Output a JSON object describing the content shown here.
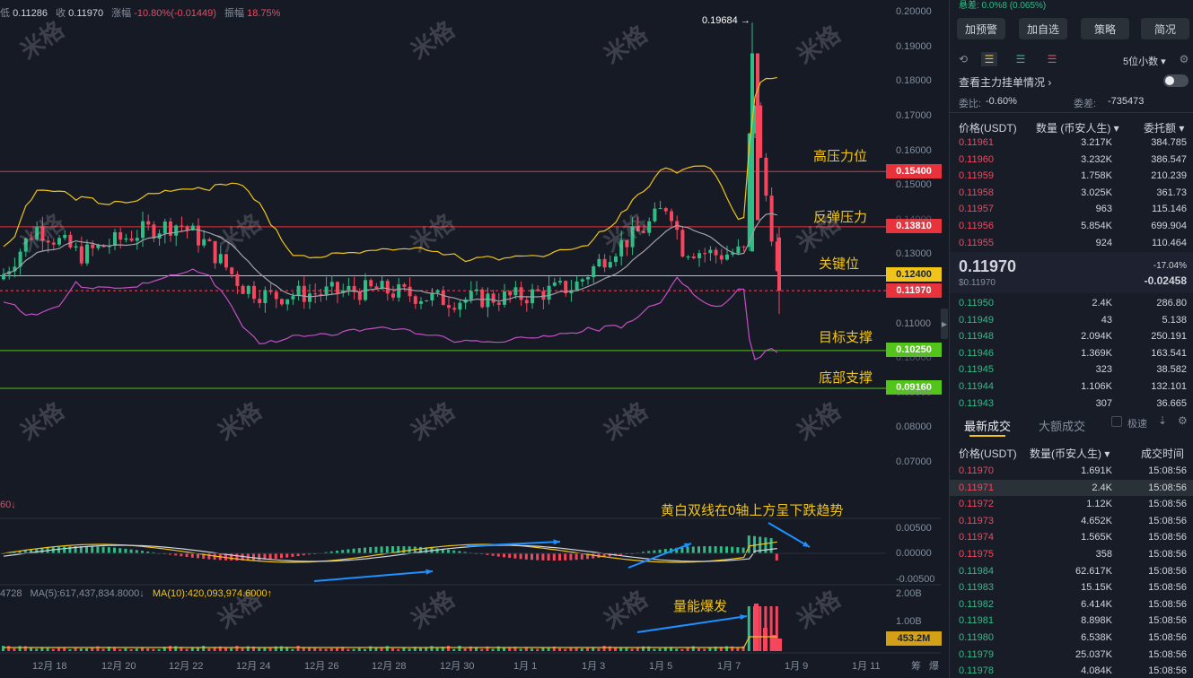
{
  "ohlc": {
    "low_label": "低",
    "low": "0.11286",
    "close_label": "收",
    "close": "0.11970",
    "change_label": "涨幅",
    "change": "-10.80%(-0.01449)",
    "amp_label": "振幅",
    "amp": "18.75%"
  },
  "watermark": "米格",
  "price_axis": [
    "0.20000",
    "0.19000",
    "0.18000",
    "0.17000",
    "0.16000",
    "0.15000",
    "0.14000",
    "0.13000",
    "0.12000",
    "0.11000",
    "0.10000",
    "0.09000",
    "0.08000",
    "0.07000"
  ],
  "macd_axis": [
    "0.00500",
    "0.00000",
    "-0.00500"
  ],
  "vol_axis": [
    "2.00B",
    "1.00B"
  ],
  "date_axis": [
    "12月 18",
    "12月 20",
    "12月 22",
    "12月 24",
    "12月 26",
    "12月 28",
    "12月 30",
    "1月 1",
    "1月 3",
    "1月 5",
    "1月 7",
    "1月 9",
    "1月 11"
  ],
  "axis_footer": [
    "筹",
    "爆"
  ],
  "levels": [
    {
      "label": "高压力位",
      "price": "0.15400",
      "color": "#e8323c"
    },
    {
      "label": "反弹压力",
      "price": "0.13810",
      "color": "#e8323c"
    },
    {
      "label": "关键位",
      "price": "0.12400",
      "color": "#f0c419"
    },
    {
      "label": "目标支撑",
      "price": "0.10250",
      "color": "#52c41a"
    },
    {
      "label": "底部支撑",
      "price": "0.09160",
      "color": "#52c41a"
    }
  ],
  "current_price_tag": "0.11970",
  "volume_tag": "453.2M",
  "peak_label": "0.19684 →",
  "macd_partial_label": "60↓",
  "annotations": {
    "macd": "黄白双线在0轴上方呈下跌趋势",
    "volume": "量能爆发"
  },
  "ma_line": {
    "left": "4728",
    "ma5": "MA(5):617,437,834.8000↓",
    "ma10": "MA(10):420,093,974.6000↑"
  },
  "chart_data": {
    "type": "candlestick",
    "note_from_axis": "price in USDT",
    "x_dates": [
      "12月 18",
      "12月 20",
      "12月 22",
      "12月 24",
      "12月 26",
      "12月 28",
      "12月 30",
      "1月 1",
      "1月 3",
      "1月 5",
      "1月 7",
      "1月 9"
    ],
    "ylim": [
      0.065,
      0.2
    ],
    "peak_high": 0.19684,
    "last_close": 0.1197,
    "horizontal_levels": [
      0.154,
      0.1381,
      0.124,
      0.1025,
      0.0916
    ]
  },
  "panel": {
    "top_partial": "悬差: 0.0%8 (0.065%)",
    "buttons": [
      "加预警",
      "加自选",
      "策略",
      "简况"
    ],
    "decimals": "5位小数",
    "depth_link": "查看主力挂单情况",
    "ratio_label": "委比:",
    "ratio": "-0.60%",
    "diff_label": "委差:",
    "diff": "-735473",
    "book_headers": [
      "价格(USDT)",
      "数量 (币安人生)",
      "委托额"
    ],
    "asks": [
      [
        "0.11961",
        "3.217K",
        "384.785"
      ],
      [
        "0.11960",
        "3.232K",
        "386.547"
      ],
      [
        "0.11959",
        "1.758K",
        "210.239"
      ],
      [
        "0.11958",
        "3.025K",
        "361.73"
      ],
      [
        "0.11957",
        "963",
        "115.146"
      ],
      [
        "0.11956",
        "5.854K",
        "699.904"
      ],
      [
        "0.11955",
        "924",
        "110.464"
      ]
    ],
    "mid_price": "0.11970",
    "mid_usd": "$0.11970",
    "mid_pct": "-17.04%",
    "mid_change": "-0.02458",
    "bids": [
      [
        "0.11950",
        "2.4K",
        "286.80"
      ],
      [
        "0.11949",
        "43",
        "5.138"
      ],
      [
        "0.11948",
        "2.094K",
        "250.191"
      ],
      [
        "0.11946",
        "1.369K",
        "163.541"
      ],
      [
        "0.11945",
        "323",
        "38.582"
      ],
      [
        "0.11944",
        "1.106K",
        "132.101"
      ],
      [
        "0.11943",
        "307",
        "36.665"
      ]
    ],
    "trade_tabs": [
      "最新成交",
      "大额成交"
    ],
    "fast_label": "极速",
    "trade_headers": [
      "价格(USDT)",
      "数量(币安人生)",
      "成交时间"
    ],
    "trades": [
      [
        "0.11970",
        "1.691K",
        "15:08:56",
        "red"
      ],
      [
        "0.11971",
        "2.4K",
        "15:08:56",
        "red"
      ],
      [
        "0.11972",
        "1.12K",
        "15:08:56",
        "red"
      ],
      [
        "0.11973",
        "4.652K",
        "15:08:56",
        "red"
      ],
      [
        "0.11974",
        "1.565K",
        "15:08:56",
        "red"
      ],
      [
        "0.11975",
        "358",
        "15:08:56",
        "red"
      ],
      [
        "0.11984",
        "62.617K",
        "15:08:56",
        "green"
      ],
      [
        "0.11983",
        "15.15K",
        "15:08:56",
        "green"
      ],
      [
        "0.11982",
        "6.414K",
        "15:08:56",
        "green"
      ],
      [
        "0.11981",
        "8.898K",
        "15:08:56",
        "green"
      ],
      [
        "0.11980",
        "6.538K",
        "15:08:56",
        "green"
      ],
      [
        "0.11979",
        "25.037K",
        "15:08:56",
        "green"
      ],
      [
        "0.11978",
        "4.084K",
        "15:08:56",
        "green"
      ]
    ]
  }
}
